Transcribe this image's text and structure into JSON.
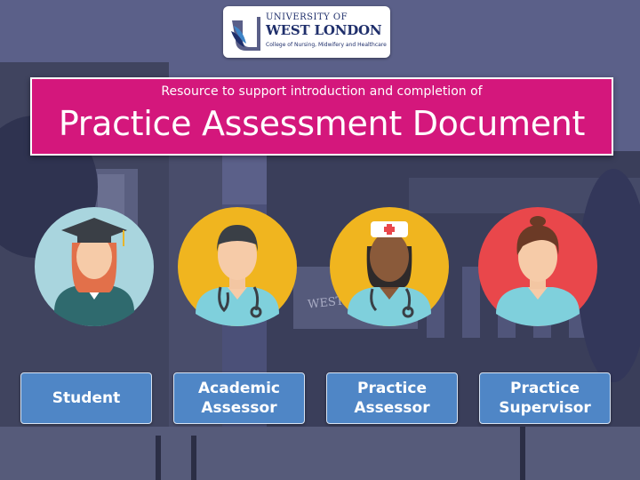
{
  "logo": {
    "line1": "UNIVERSITY OF",
    "line2": "WEST LONDON",
    "line3": "College of Nursing, Midwifery and Healthcare"
  },
  "banner": {
    "subtitle": "Resource to support introduction and completion of",
    "title": "Practice Assessment Document"
  },
  "background_sign": "WEST LONDON",
  "roles": [
    {
      "label": "Student",
      "icon": "student-graduate-icon",
      "circle_color": "#a9d5de"
    },
    {
      "label": "Academic\nAssessor",
      "icon": "academic-assessor-icon",
      "circle_color": "#f0b51f"
    },
    {
      "label": "Practice\nAssessor",
      "icon": "practice-assessor-nurse-icon",
      "circle_color": "#f0b51f"
    },
    {
      "label": "Practice\nSupervisor",
      "icon": "practice-supervisor-icon",
      "circle_color": "#e9474b"
    }
  ],
  "colors": {
    "banner": "#d4177c",
    "button": "#4f86c6",
    "overlay": "#3d4266"
  }
}
